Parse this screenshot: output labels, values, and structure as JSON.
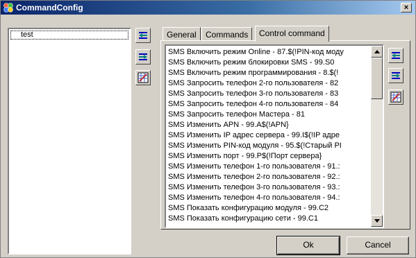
{
  "window": {
    "title": "CommandConfig",
    "close_label": "×"
  },
  "left_list": {
    "items": [
      "test"
    ]
  },
  "tabs": [
    "General",
    "Commands",
    "Control command"
  ],
  "commands": [
    "SMS Включить режим Online - 87.$(!PIN-код моду",
    "SMS Включить режим блокировки SMS - 99.S0",
    "SMS Включить режим программирования - 8.$(!",
    "SMS Запросить телефон 2-го пользователя - 82",
    "SMS Запросить телефон 3-го пользователя - 83",
    "SMS Запросить телефон 4-го пользователя - 84",
    "SMS Запросить телефон Мастера - 81",
    "SMS Изменить APN - 99.A$(!APN}",
    "SMS Изменить IP адрес сервера - 99.I$(!IP адре",
    "SMS Изменить PIN-код модуля - 95.$(!Старый PI",
    "SMS Изменить порт - 99.P$(!Порт сервера}",
    "SMS Изменить телефон 1-го пользователя - 91.:",
    "SMS Изменить телефон 2-го пользователя - 92.:",
    "SMS Изменить телефон 3-го пользователя - 93.:",
    "SMS Изменить телефон 4-го пользователя - 94.:",
    "SMS Показать конфигурацию модуля - 99.C2",
    "SMS Показать конфигурацию сети - 99.C1"
  ],
  "buttons": {
    "ok": "Ok",
    "cancel": "Cancel"
  },
  "icons": [
    "move-left-icon",
    "move-right-icon",
    "edit-grid-icon"
  ]
}
